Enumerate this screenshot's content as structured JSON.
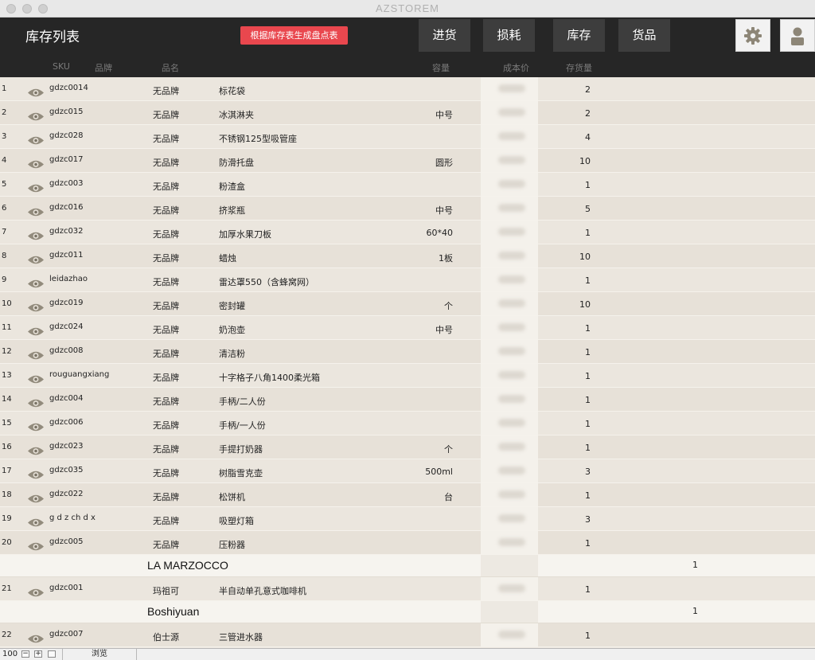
{
  "window": {
    "title": "AZSTOREM"
  },
  "header": {
    "title": "库存列表",
    "generate_button": "根据库存表生成盘点表",
    "nav": [
      "进货",
      "损耗",
      "库存",
      "货品"
    ]
  },
  "columns": {
    "sku": "SKU",
    "brand": "品牌",
    "name": "品名",
    "capacity": "容量",
    "cost": "成本价",
    "stock": "存货量"
  },
  "rows": [
    {
      "no": "1",
      "sku": "gdzc0014",
      "brand": "无品牌",
      "name": "标花袋",
      "capacity": "",
      "stock": "2"
    },
    {
      "no": "2",
      "sku": "gdzc015",
      "brand": "无品牌",
      "name": "冰淇淋夹",
      "capacity": "中号",
      "stock": "2"
    },
    {
      "no": "3",
      "sku": "gdzc028",
      "brand": "无品牌",
      "name": "不锈钢125型吸管座",
      "capacity": "",
      "stock": "4"
    },
    {
      "no": "4",
      "sku": "gdzc017",
      "brand": "无品牌",
      "name": "防滑托盘",
      "capacity": "圆形",
      "stock": "10"
    },
    {
      "no": "5",
      "sku": "gdzc003",
      "brand": "无品牌",
      "name": "粉渣盒",
      "capacity": "",
      "stock": "1"
    },
    {
      "no": "6",
      "sku": "gdzc016",
      "brand": "无品牌",
      "name": "挤浆瓶",
      "capacity": "中号",
      "stock": "5"
    },
    {
      "no": "7",
      "sku": "gdzc032",
      "brand": "无品牌",
      "name": "加厚水果刀板",
      "capacity": "60*40",
      "stock": "1"
    },
    {
      "no": "8",
      "sku": "gdzc011",
      "brand": "无品牌",
      "name": "蜡烛",
      "capacity": "1板",
      "stock": "10"
    },
    {
      "no": "9",
      "sku": "leidazhao",
      "brand": "无品牌",
      "name": "雷达罩550（含蜂窝网）",
      "capacity": "",
      "stock": "1"
    },
    {
      "no": "10",
      "sku": "gdzc019",
      "brand": "无品牌",
      "name": "密封罐",
      "capacity": "个",
      "stock": "10"
    },
    {
      "no": "11",
      "sku": "gdzc024",
      "brand": "无品牌",
      "name": "奶泡壶",
      "capacity": "中号",
      "stock": "1"
    },
    {
      "no": "12",
      "sku": "gdzc008",
      "brand": "无品牌",
      "name": "清洁粉",
      "capacity": "",
      "stock": "1"
    },
    {
      "no": "13",
      "sku": "rouguangxiang",
      "brand": "无品牌",
      "name": "十字格子八角1400柔光箱",
      "capacity": "",
      "stock": "1"
    },
    {
      "no": "14",
      "sku": "gdzc004",
      "brand": "无品牌",
      "name": "手柄/二人份",
      "capacity": "",
      "stock": "1"
    },
    {
      "no": "15",
      "sku": "gdzc006",
      "brand": "无品牌",
      "name": "手柄/一人份",
      "capacity": "",
      "stock": "1"
    },
    {
      "no": "16",
      "sku": "gdzc023",
      "brand": "无品牌",
      "name": "手提打奶器",
      "capacity": "个",
      "stock": "1"
    },
    {
      "no": "17",
      "sku": "gdzc035",
      "brand": "无品牌",
      "name": "树脂雪克壶",
      "capacity": "500ml",
      "stock": "3"
    },
    {
      "no": "18",
      "sku": "gdzc022",
      "brand": "无品牌",
      "name": "松饼机",
      "capacity": "台",
      "stock": "1"
    },
    {
      "no": "19",
      "sku": "g d z ch d x",
      "brand": "无品牌",
      "name": "吸塑灯箱",
      "capacity": "",
      "stock": "3"
    },
    {
      "no": "20",
      "sku": "gdzc005",
      "brand": "无品牌",
      "name": "压粉器",
      "capacity": "",
      "stock": "1"
    }
  ],
  "groups": [
    {
      "name": "LA MARZOCCO",
      "count": "1",
      "rows": [
        {
          "no": "21",
          "sku": "gdzc001",
          "brand": "玛祖可",
          "name": "半自动单孔意式咖啡机",
          "capacity": "",
          "stock": "1"
        }
      ]
    },
    {
      "name": "Boshiyuan",
      "count": "1",
      "rows": [
        {
          "no": "22",
          "sku": "gdzc007",
          "brand": "伯士源",
          "name": "三管进水器",
          "capacity": "",
          "stock": "1"
        }
      ]
    }
  ],
  "statusbar": {
    "zoom": "100",
    "mode": "浏览"
  },
  "icons": [
    "eye-icon",
    "gear-icon",
    "user-icon"
  ]
}
